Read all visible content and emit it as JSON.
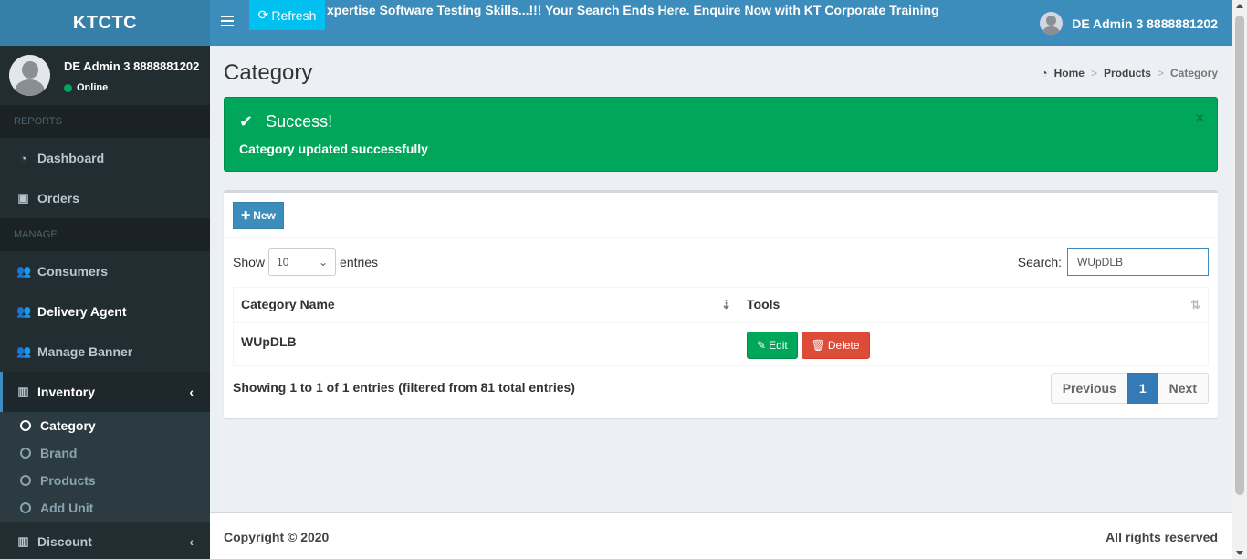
{
  "app": {
    "logo": "KTCTC"
  },
  "topbar": {
    "refresh_label": "Refresh",
    "marquee": "xpertise Software Testing Skills...!!! Your Search Ends Here. Enquire Now with KT Corporate Training Centre fo",
    "user_name": "DE Admin 3 8888881202"
  },
  "sidebar": {
    "user_name": "DE Admin 3 8888881202",
    "status": "Online",
    "reports_header": "REPORTS",
    "manage_header": "MANAGE",
    "items": [
      {
        "label": "Dashboard",
        "icon": "dashboard-icon"
      },
      {
        "label": "Orders",
        "icon": "money-icon"
      },
      {
        "label": "Consumers",
        "icon": "users-icon"
      },
      {
        "label": "Delivery Agent",
        "icon": "users-icon"
      },
      {
        "label": "Manage Banner",
        "icon": "users-icon"
      },
      {
        "label": "Inventory",
        "icon": "barcode-icon"
      },
      {
        "label": "Discount",
        "icon": "barcode-icon"
      }
    ],
    "inventory_sub": [
      {
        "label": "Category"
      },
      {
        "label": "Brand"
      },
      {
        "label": "Products"
      },
      {
        "label": "Add Unit"
      }
    ]
  },
  "page": {
    "title": "Category",
    "breadcrumb": {
      "home": "Home",
      "products": "Products",
      "current": "Category"
    }
  },
  "alert": {
    "title": "Success!",
    "message": "Category updated successfully",
    "close": "×"
  },
  "table_controls": {
    "new_label": "New",
    "show_label": "Show",
    "entries_value": "10",
    "entries_label": "entries",
    "search_label": "Search:",
    "search_value": "WUpDLB"
  },
  "table": {
    "columns": [
      "Category Name",
      "Tools"
    ],
    "rows": [
      {
        "name": "WUpDLB",
        "edit": "Edit",
        "delete": "Delete"
      }
    ]
  },
  "pagination": {
    "info": "Showing 1 to 1 of 1 entries (filtered from 81 total entries)",
    "previous": "Previous",
    "current_page": "1",
    "next": "Next"
  },
  "footer": {
    "copyright": "Copyright © 2020",
    "rights": "All rights reserved"
  },
  "colors": {
    "header": "#3c8dbc",
    "logo_bg": "#367fa9",
    "sidebar": "#222d32",
    "success": "#00a65a",
    "danger": "#dd4b39",
    "info_btn": "#00c0ef"
  }
}
